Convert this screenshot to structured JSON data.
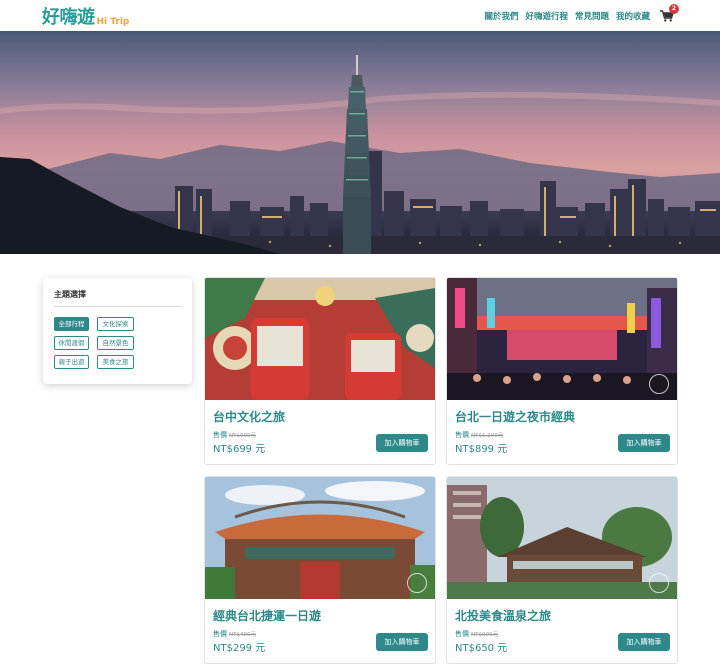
{
  "header": {
    "logo_main": "好嗨遊",
    "logo_sub": "Hi Trip",
    "nav": [
      "關於我們",
      "好嗨遊行程",
      "常見問題",
      "我的收藏"
    ],
    "cart_count": "2"
  },
  "filter": {
    "title": "主題選擇",
    "tags": [
      "全部行程",
      "文化探索",
      "休閒渡假",
      "自然景色",
      "親子出遊",
      "美食之旅"
    ]
  },
  "tours": [
    {
      "title": "台中文化之旅",
      "price_label": "售價",
      "orig_price": "NT$900元",
      "sale_price": "NT$699 元",
      "button": "加入購物車"
    },
    {
      "title": "台北一日遊之夜市經典",
      "price_label": "售價",
      "orig_price": "NT$1,200元",
      "sale_price": "NT$899 元",
      "button": "加入購物車"
    },
    {
      "title": "經典台北捷運一日遊",
      "price_label": "售價",
      "orig_price": "NT$400元",
      "sale_price": "NT$299 元",
      "button": "加入購物車"
    },
    {
      "title": "北投美食溫泉之旅",
      "price_label": "售價",
      "orig_price": "NT$900元",
      "sale_price": "NT$650 元",
      "button": "加入購物車"
    }
  ],
  "colors": {
    "accent": "#2e8a8a",
    "logo_orange": "#f0a23a",
    "badge": "#d83a3a"
  }
}
